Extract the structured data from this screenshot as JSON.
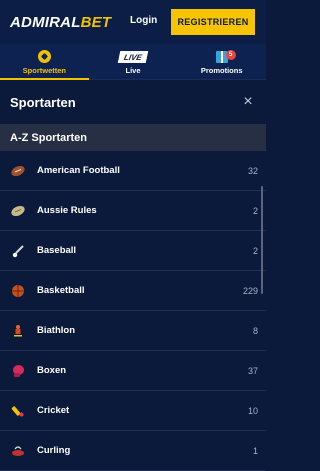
{
  "header": {
    "logo_part1": "ADMIRAL",
    "logo_part2": "BET",
    "login_label": "Login",
    "register_label": "REGISTRIEREN"
  },
  "nav": {
    "items": [
      {
        "label": "Sportwetten",
        "icon": "soccer-ball-icon",
        "active": true
      },
      {
        "label": "Live",
        "icon": "live-icon",
        "icon_text": "LIVE"
      },
      {
        "label": "Promotions",
        "icon": "gift-icon",
        "badge": "5"
      }
    ]
  },
  "panel": {
    "title": "Sportarten",
    "close_symbol": "×",
    "section_title": "A-Z Sportarten"
  },
  "sports": [
    {
      "label": "American Football",
      "count": "32",
      "icon": "american-football-icon"
    },
    {
      "label": "Aussie Rules",
      "count": "2",
      "icon": "aussie-rules-ball-icon"
    },
    {
      "label": "Baseball",
      "count": "2",
      "icon": "baseball-icon"
    },
    {
      "label": "Basketball",
      "count": "229",
      "icon": "basketball-icon"
    },
    {
      "label": "Biathlon",
      "count": "8",
      "icon": "biathlon-icon"
    },
    {
      "label": "Boxen",
      "count": "37",
      "icon": "boxing-glove-icon"
    },
    {
      "label": "Cricket",
      "count": "10",
      "icon": "cricket-icon"
    },
    {
      "label": "Curling",
      "count": "1",
      "icon": "curling-stone-icon"
    }
  ],
  "colors": {
    "accent": "#f2c200",
    "background": "#0b1a3a",
    "section_bg": "#272f44"
  }
}
